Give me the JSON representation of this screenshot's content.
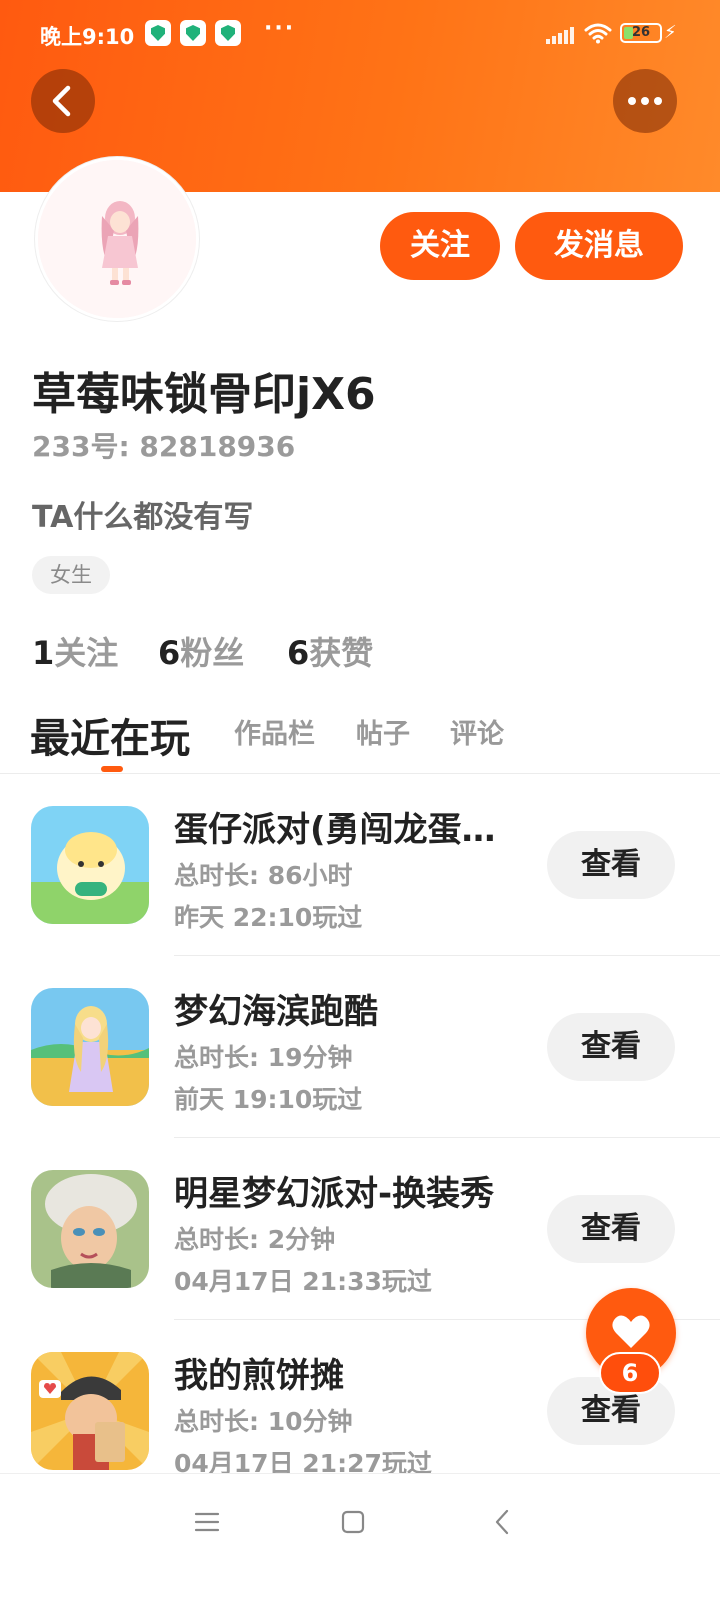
{
  "status_bar": {
    "time": "晚上9:10",
    "more": "···",
    "battery": "26",
    "battery_level": 0.26
  },
  "header": {
    "back_icon": "chevron-left-icon",
    "more_icon": "more-horizontal-icon",
    "accent_color": "#ff5a0f"
  },
  "profile": {
    "name": "草莓味锁骨印jX6",
    "uid": "233号: 82818936",
    "bio": "TA什么都没有写",
    "gender_tag": "女生",
    "follow_label": "关注",
    "message_label": "发消息"
  },
  "stats": [
    {
      "num": "1",
      "label": "关注"
    },
    {
      "num": "6",
      "label": "粉丝"
    },
    {
      "num": "6",
      "label": "获赞"
    }
  ],
  "tabs": [
    {
      "label": "最近在玩",
      "active": true
    },
    {
      "label": "作品栏",
      "active": false
    },
    {
      "label": "帖子",
      "active": false
    },
    {
      "label": "评论",
      "active": false
    }
  ],
  "games": [
    {
      "title": "蛋仔派对(勇闯龙蛋…",
      "duration": "总时长: 86小时",
      "played": "昨天 22:10玩过",
      "action": "查看"
    },
    {
      "title": "梦幻海滨跑酷",
      "duration": "总时长: 19分钟",
      "played": "前天 19:10玩过",
      "action": "查看"
    },
    {
      "title": "明星梦幻派对-换装秀",
      "duration": "总时长: 2分钟",
      "played": "04月17日 21:33玩过",
      "action": "查看"
    },
    {
      "title": "我的煎饼摊",
      "duration": "总时长: 10分钟",
      "played": "04月17日 21:27玩过",
      "action": "查看"
    }
  ],
  "like_fab": {
    "icon": "heart-icon",
    "count": "6"
  },
  "nav": {
    "menu_icon": "menu-icon",
    "home_icon": "square-icon",
    "back_icon": "back-triangle-icon"
  }
}
